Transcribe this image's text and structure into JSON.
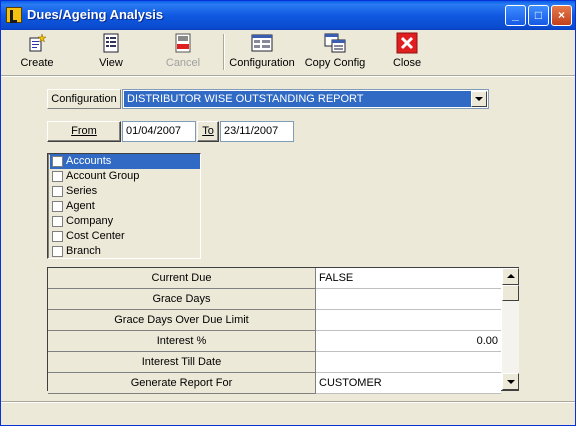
{
  "window": {
    "title": "Dues/Ageing Analysis"
  },
  "toolbar": {
    "create": "Create",
    "view": "View",
    "cancel": "Cancel",
    "configuration": "Configuration",
    "copy_config": "Copy Config",
    "close": "Close"
  },
  "config": {
    "label": "Configuration",
    "selected": "DISTRIBUTOR WISE OUTSTANDING REPORT"
  },
  "dates": {
    "from_label": "From",
    "from_value": "01/04/2007",
    "to_label": "To",
    "to_value": "23/11/2007"
  },
  "groups": [
    {
      "label": "Accounts",
      "checked": false,
      "selected": true
    },
    {
      "label": "Account Group",
      "checked": false,
      "selected": false
    },
    {
      "label": "Series",
      "checked": false,
      "selected": false
    },
    {
      "label": "Agent",
      "checked": false,
      "selected": false
    },
    {
      "label": "Company",
      "checked": false,
      "selected": false
    },
    {
      "label": "Cost Center",
      "checked": false,
      "selected": false
    },
    {
      "label": "Branch",
      "checked": false,
      "selected": false
    }
  ],
  "properties": [
    {
      "key": "Current Due",
      "value": "FALSE"
    },
    {
      "key": "Grace Days",
      "value": ""
    },
    {
      "key": "Grace Days Over Due Limit",
      "value": ""
    },
    {
      "key": "Interest %",
      "value": "0.00"
    },
    {
      "key": "Interest Till Date",
      "value": ""
    },
    {
      "key": "Generate Report For",
      "value": "CUSTOMER"
    }
  ],
  "colors": {
    "titlebar": "#0a4cd0",
    "selection": "#316ac5",
    "face": "#ece9d8"
  }
}
